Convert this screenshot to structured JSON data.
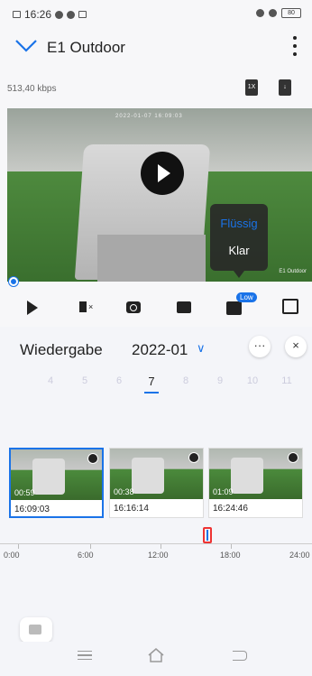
{
  "status_bar": {
    "time": "16:26",
    "battery": "80"
  },
  "header": {
    "title": "E1 Outdoor"
  },
  "stream": {
    "bitrate": "513,40 kbps",
    "speed_button": "1X",
    "timestamp": "2022-01-07 16:09:03",
    "corner_label": "E1 Outdoor"
  },
  "quality_menu": {
    "options": [
      "Flüssig",
      "Klar"
    ],
    "selected": "Flüssig",
    "option_colors": [
      "#1a73e8",
      "#ffffff"
    ]
  },
  "controls": {
    "quality_badge": "Low"
  },
  "playback": {
    "title": "Wiedergabe",
    "month": "2022-01",
    "more_label": "···",
    "close_label": "×",
    "days": [
      "4",
      "5",
      "6",
      "7",
      "8",
      "9",
      "10",
      "11"
    ],
    "selected_day": "7",
    "clips": [
      {
        "duration": "00:59",
        "time": "16:09:03"
      },
      {
        "duration": "00:38",
        "time": "16:16:14"
      },
      {
        "duration": "01:09",
        "time": "16:24:46"
      }
    ],
    "timeline_labels": [
      "0:00",
      "6:00",
      "12:00",
      "18:00",
      "24:00"
    ]
  },
  "colors": {
    "accent": "#1a73e8",
    "marker": "#e33333"
  }
}
